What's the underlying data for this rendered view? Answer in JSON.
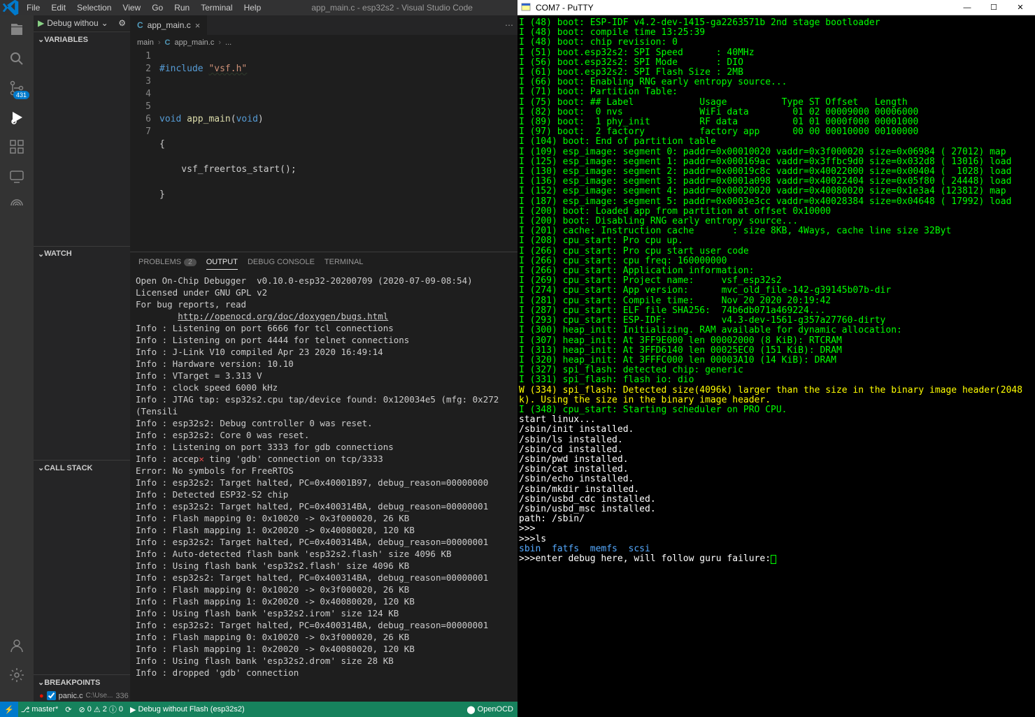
{
  "vscode": {
    "menubar": {
      "items": [
        "File",
        "Edit",
        "Selection",
        "View",
        "Go",
        "Run",
        "Terminal",
        "Help"
      ],
      "title": "app_main.c - esp32s2 - Visual Studio Code"
    },
    "run_config": "Debug withou",
    "scm_badge": "431",
    "sections": {
      "variables": "VARIABLES",
      "watch": "WATCH",
      "callstack": "CALL STACK",
      "breakpoints": "BREAKPOINTS"
    },
    "breakpoint": {
      "file": "panic.c",
      "path": "C:\\Use...",
      "line": "336"
    },
    "tab": {
      "name": "app_main.c",
      "icon": "C"
    },
    "breadcrumbs": [
      "main",
      "app_main.c",
      "..."
    ],
    "code": {
      "lines": [
        "1",
        "2",
        "3",
        "4",
        "5",
        "6",
        "7"
      ],
      "l1_include": "#include",
      "l1_str": "\"vsf.h\"",
      "l3_void": "void",
      "l3_fn": "app_main",
      "l3_void2": "void",
      "l4": "{",
      "l5": "    vsf_freertos_start();",
      "l6": "}"
    },
    "panel_tabs": {
      "problems": "PROBLEMS",
      "problems_count": "2",
      "output": "OUTPUT",
      "debug_console": "DEBUG CONSOLE",
      "terminal": "TERMINAL"
    },
    "output": [
      "Open On-Chip Debugger  v0.10.0-esp32-20200709 (2020-07-09-08:54)",
      "Licensed under GNU GPL v2",
      "For bug reports, read",
      "        http://openocd.org/doc/doxygen/bugs.html",
      "Info : Listening on port 6666 for tcl connections",
      "Info : Listening on port 4444 for telnet connections",
      "Info : J-Link V10 compiled Apr 23 2020 16:49:14",
      "Info : Hardware version: 10.10",
      "Info : VTarget = 3.313 V",
      "Info : clock speed 6000 kHz",
      "Info : JTAG tap: esp32s2.cpu tap/device found: 0x120034e5 (mfg: 0x272 (Tensili",
      "Info : esp32s2: Debug controller 0 was reset.",
      "Info : esp32s2: Core 0 was reset.",
      "Info : Listening on port 3333 for gdb connections",
      "Info : accep✕ ting 'gdb' connection on tcp/3333",
      "Error: No symbols for FreeRTOS",
      "Info : esp32s2: Target halted, PC=0x40001B97, debug_reason=00000000",
      "Info : Detected ESP32-S2 chip",
      "Info : esp32s2: Target halted, PC=0x400314BA, debug_reason=00000001",
      "Info : Flash mapping 0: 0x10020 -> 0x3f000020, 26 KB",
      "Info : Flash mapping 1: 0x20020 -> 0x40080020, 120 KB",
      "Info : esp32s2: Target halted, PC=0x400314BA, debug_reason=00000001",
      "Info : Auto-detected flash bank 'esp32s2.flash' size 4096 KB",
      "Info : Using flash bank 'esp32s2.flash' size 4096 KB",
      "Info : esp32s2: Target halted, PC=0x400314BA, debug_reason=00000001",
      "Info : Flash mapping 0: 0x10020 -> 0x3f000020, 26 KB",
      "Info : Flash mapping 1: 0x20020 -> 0x40080020, 120 KB",
      "Info : Using flash bank 'esp32s2.irom' size 124 KB",
      "Info : esp32s2: Target halted, PC=0x400314BA, debug_reason=00000001",
      "Info : Flash mapping 0: 0x10020 -> 0x3f000020, 26 KB",
      "Info : Flash mapping 1: 0x20020 -> 0x40080020, 120 KB",
      "Info : Using flash bank 'esp32s2.drom' size 28 KB",
      "Info : dropped 'gdb' connection"
    ],
    "statusbar": {
      "branch": "master*",
      "sync": "",
      "errs": "0",
      "warns": "2",
      "info": "0",
      "debug_label": "Debug without Flash (esp32s2)",
      "openocd": "OpenOCD"
    }
  },
  "putty": {
    "title": "COM7 - PuTTY",
    "lines_green": [
      "I (48) boot: ESP-IDF v4.2-dev-1415-ga2263571b 2nd stage bootloader",
      "I (48) boot: compile time 13:25:39",
      "I (48) boot: chip revision: 0",
      "I (51) boot.esp32s2: SPI Speed      : 40MHz",
      "I (56) boot.esp32s2: SPI Mode       : DIO",
      "I (61) boot.esp32s2: SPI Flash Size : 2MB",
      "I (66) boot: Enabling RNG early entropy source...",
      "I (71) boot: Partition Table:",
      "I (75) boot: ## Label            Usage          Type ST Offset   Length",
      "I (82) boot:  0 nvs              WiFi data        01 02 00009000 00006000",
      "I (89) boot:  1 phy_init         RF data          01 01 0000f000 00001000",
      "I (97) boot:  2 factory          factory app      00 00 00010000 00100000",
      "I (104) boot: End of partition table",
      "I (109) esp_image: segment 0: paddr=0x00010020 vaddr=0x3f000020 size=0x06984 ( 27012) map",
      "I (125) esp_image: segment 1: paddr=0x000169ac vaddr=0x3ffbc9d0 size=0x032d8 ( 13016) load",
      "I (130) esp_image: segment 2: paddr=0x00019c8c vaddr=0x40022000 size=0x00404 (  1028) load",
      "I (136) esp_image: segment 3: paddr=0x0001a098 vaddr=0x40022404 size=0x05f80 ( 24448) load",
      "I (152) esp_image: segment 4: paddr=0x00020020 vaddr=0x40080020 size=0x1e3a4 (123812) map",
      "I (187) esp_image: segment 5: paddr=0x0003e3cc vaddr=0x40028384 size=0x04648 ( 17992) load",
      "I (200) boot: Loaded app from partition at offset 0x10000",
      "I (200) boot: Disabling RNG early entropy source...",
      "I (201) cache: Instruction cache       : size 8KB, 4Ways, cache line size 32Byt",
      "",
      "I (208) cpu_start: Pro cpu up.",
      "I (266) cpu_start: Pro cpu start user code",
      "I (266) cpu_start: cpu freq: 160000000",
      "I (266) cpu_start: Application information:",
      "I (269) cpu_start: Project name:     vsf_esp32s2",
      "I (274) cpu_start: App version:      mvc_old_file-142-g39145b07b-dir",
      "I (281) cpu_start: Compile time:     Nov 20 2020 20:19:42",
      "I (287) cpu_start: ELF file SHA256:  74b6db071a469224...",
      "I (293) cpu_start: ESP-IDF:          v4.3-dev-1561-g357a27760-dirty",
      "I (300) heap_init: Initializing. RAM available for dynamic allocation:",
      "I (307) heap_init: At 3FF9E000 len 00002000 (8 KiB): RTCRAM",
      "I (313) heap_init: At 3FFD6140 len 00025EC0 (151 KiB): DRAM",
      "I (320) heap_init: At 3FFFC000 len 00003A10 (14 KiB): DRAM",
      "I (327) spi_flash: detected chip: generic",
      "I (331) spi_flash: flash io: dio"
    ],
    "line_warn": "W (334) spi_flash: Detected size(4096k) larger than the size in the binary image header(2048k). Using the size in the binary image header.",
    "line_green2": "I (348) cpu_start: Starting scheduler on PRO CPU.",
    "lines_white": [
      "start linux...",
      "/sbin/init installed.",
      "/sbin/ls installed.",
      "/sbin/cd installed.",
      "/sbin/pwd installed.",
      "/sbin/cat installed.",
      "/sbin/echo installed.",
      "/sbin/mkdir installed.",
      "/sbin/usbd_cdc installed.",
      "/sbin/usbd_msc installed.",
      "path: /sbin/",
      ">>>",
      ">>>ls"
    ],
    "ls_out": "sbin  fatfs  memfs  scsi",
    "prompt": ">>>enter debug here, will follow guru failure:"
  }
}
